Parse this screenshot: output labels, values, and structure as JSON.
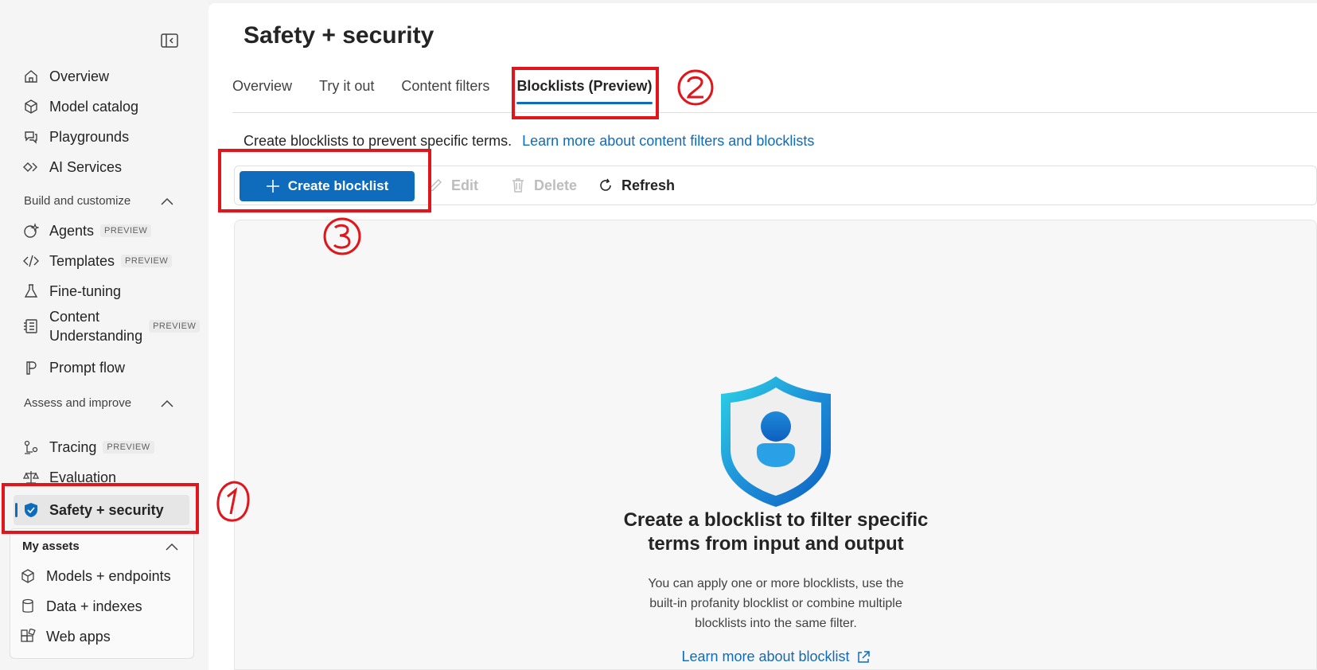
{
  "sidebar": {
    "items": [
      {
        "label": "Overview",
        "icon": "home-icon"
      },
      {
        "label": "Model catalog",
        "icon": "cube-stack-icon"
      },
      {
        "label": "Playgrounds",
        "icon": "chat-bubbles-icon"
      },
      {
        "label": "AI Services",
        "icon": "diamond-icon"
      }
    ],
    "build_section": {
      "title": "Build and customize",
      "items": [
        {
          "label": "Agents",
          "badge": "PREVIEW",
          "icon": "sparkle-icon"
        },
        {
          "label": "Templates",
          "badge": "PREVIEW",
          "icon": "code-icon"
        },
        {
          "label": "Fine-tuning",
          "icon": "flask-icon"
        },
        {
          "label_line1": "Content",
          "label_line2": "Understanding",
          "badge": "PREVIEW",
          "icon": "document-list-icon"
        },
        {
          "label": "Prompt flow",
          "icon": "flow-icon"
        }
      ]
    },
    "assess_section": {
      "title": "Assess and improve",
      "items": [
        {
          "label": "Tracing",
          "badge": "PREVIEW",
          "icon": "tracing-icon"
        },
        {
          "label": "Evaluation",
          "icon": "scales-icon"
        },
        {
          "label": "Safety + security",
          "icon": "shield-icon",
          "active": true
        }
      ]
    },
    "assets_section": {
      "title": "My assets",
      "items": [
        {
          "label": "Models + endpoints",
          "icon": "cube-icon"
        },
        {
          "label": "Data + indexes",
          "icon": "database-icon"
        },
        {
          "label": "Web apps",
          "icon": "apps-icon"
        }
      ]
    }
  },
  "main": {
    "title": "Safety + security",
    "tabs": [
      {
        "label": "Overview"
      },
      {
        "label": "Try it out"
      },
      {
        "label": "Content filters"
      },
      {
        "label": "Blocklists (Preview)",
        "active": true
      }
    ],
    "description": "Create blocklists to prevent specific terms.",
    "description_link": "Learn more about content filters and blocklists",
    "toolbar": {
      "create": "Create blocklist",
      "edit": "Edit",
      "delete": "Delete",
      "refresh": "Refresh"
    },
    "empty_state": {
      "title_line1": "Create a blocklist to filter specific",
      "title_line2": "terms from input and output",
      "body_line1": "You can apply one or more blocklists, use the",
      "body_line2": "built-in profanity blocklist or combine multiple",
      "body_line3": "blocklists into the same filter.",
      "link": "Learn more about blocklist"
    }
  },
  "annotations": {
    "step1": "1",
    "step2": "2",
    "step3": "3",
    "color": "#e0161c"
  },
  "colors": {
    "accent": "#0f6cbd"
  }
}
